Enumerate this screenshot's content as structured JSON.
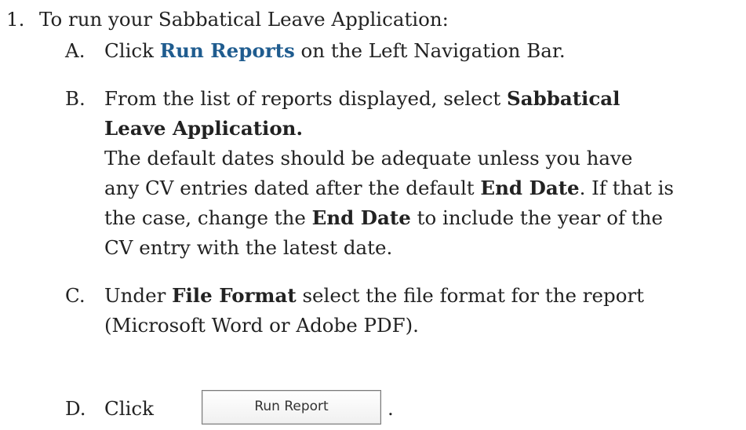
{
  "step": {
    "number": "1.",
    "intro": "To run your Sabbatical Leave Application:"
  },
  "items": {
    "a": {
      "letter": "A.",
      "pre": "Click ",
      "link": "Run Reports",
      "post": " on the Left Navigation Bar."
    },
    "b": {
      "letter": "B.",
      "line1_pre": "From the list of reports displayed, select ",
      "line1_bold": "Sabbatical",
      "line2_bold": "Leave Application.",
      "line3": "The default dates should be adequate unless you have",
      "line4_pre": "any CV entries dated after the default ",
      "line4_bold": "End Date",
      "line4_post": ". If that is",
      "line5_pre": "the case, change the ",
      "line5_bold": "End Date",
      "line5_post": " to include the year of the",
      "line6": "CV entry with the latest date."
    },
    "c": {
      "letter": "C.",
      "line1_pre": "Under ",
      "line1_bold": "File Format",
      "line1_post": " select the file format for the report",
      "line2": "(Microsoft Word or Adobe PDF)."
    },
    "d": {
      "letter": "D.",
      "pre": "Click",
      "button_label": "Run Report",
      "post": "."
    }
  }
}
